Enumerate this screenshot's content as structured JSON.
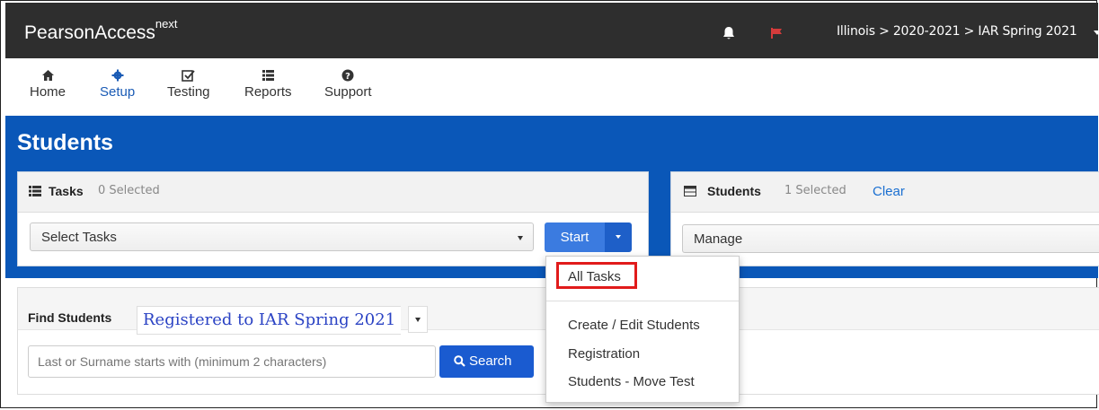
{
  "app": {
    "brand": "PearsonAccess",
    "brand_sup": "next",
    "breadcrumb": "Illinois > 2020-2021 > IAR Spring 2021"
  },
  "nav": [
    {
      "label": "Home",
      "icon": "home-icon",
      "active": false
    },
    {
      "label": "Setup",
      "icon": "gear-icon",
      "active": true
    },
    {
      "label": "Testing",
      "icon": "checkbox-icon",
      "active": false
    },
    {
      "label": "Reports",
      "icon": "reports-icon",
      "active": false
    },
    {
      "label": "Support",
      "icon": "help-icon",
      "active": false
    }
  ],
  "page": {
    "title": "Students"
  },
  "tasks_panel": {
    "title": "Tasks",
    "count": "0 Selected",
    "select_label": "Select Tasks",
    "start_label": "Start"
  },
  "students_panel": {
    "title": "Students",
    "count": "1 Selected",
    "clear_label": "Clear",
    "manage_label": "Manage"
  },
  "find": {
    "title": "Find Students",
    "filter": "Registered to IAR Spring 2021",
    "search_placeholder": "Last or Surname starts with (minimum 2 characters)",
    "search_label": "Search"
  },
  "dropdown": {
    "highlighted": "All Tasks",
    "items": [
      "Create / Edit Students",
      "Registration",
      "Students - Move Test"
    ]
  },
  "colors": {
    "header": "#2e2e2e",
    "band": "#0a57b8",
    "accent": "#3b7be0",
    "highlight": "#e11b1b"
  }
}
